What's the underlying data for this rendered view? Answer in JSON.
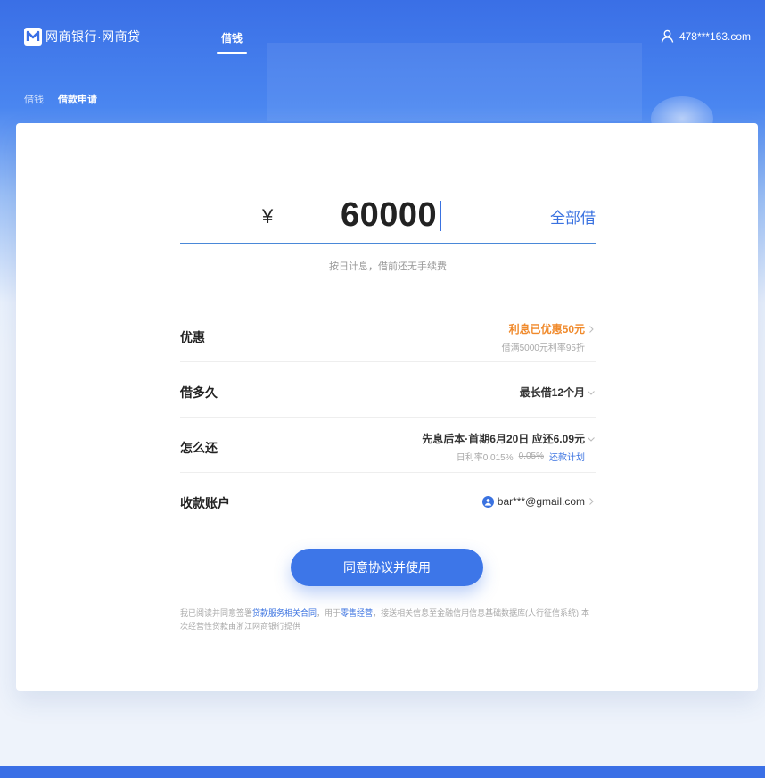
{
  "header": {
    "logo_text": "网商银行·网商贷",
    "nav_tab": "借钱",
    "user_account": "478***163.com"
  },
  "breadcrumb": {
    "parent": "借钱",
    "current": "借款申请"
  },
  "amount": {
    "currency_symbol": "¥",
    "value": "60000",
    "borrow_all_label": "全部借",
    "hint": "按日计息，借前还无手续费"
  },
  "options": {
    "discount": {
      "label": "优惠",
      "value": "利息已优惠50元",
      "sub": "借满5000元利率95折"
    },
    "term": {
      "label": "借多久",
      "value": "最长借12个月"
    },
    "repay": {
      "label": "怎么还",
      "value": "先息后本·首期6月20日 应还6.09元",
      "rate_label": "日利率0.015%",
      "rate_original": "0.05%",
      "plan_link": "还款计划"
    },
    "account": {
      "label": "收款账户",
      "value": "bar***@gmail.com"
    }
  },
  "submit_label": "同意协议并使用",
  "agreement": {
    "prefix": "我已阅读并同意签署",
    "link1": "贷款服务相关合同",
    "mid": "，用于",
    "link2": "零售经营",
    "suffix": "，接送相关信息至金融信用信息基础数据库(人行征信系统)·本次经营性贷款由浙江网商银行提供"
  },
  "colors": {
    "brand_blue": "#3d76e8",
    "accent_orange": "#f08a2c",
    "link_blue": "#3a72e0"
  }
}
